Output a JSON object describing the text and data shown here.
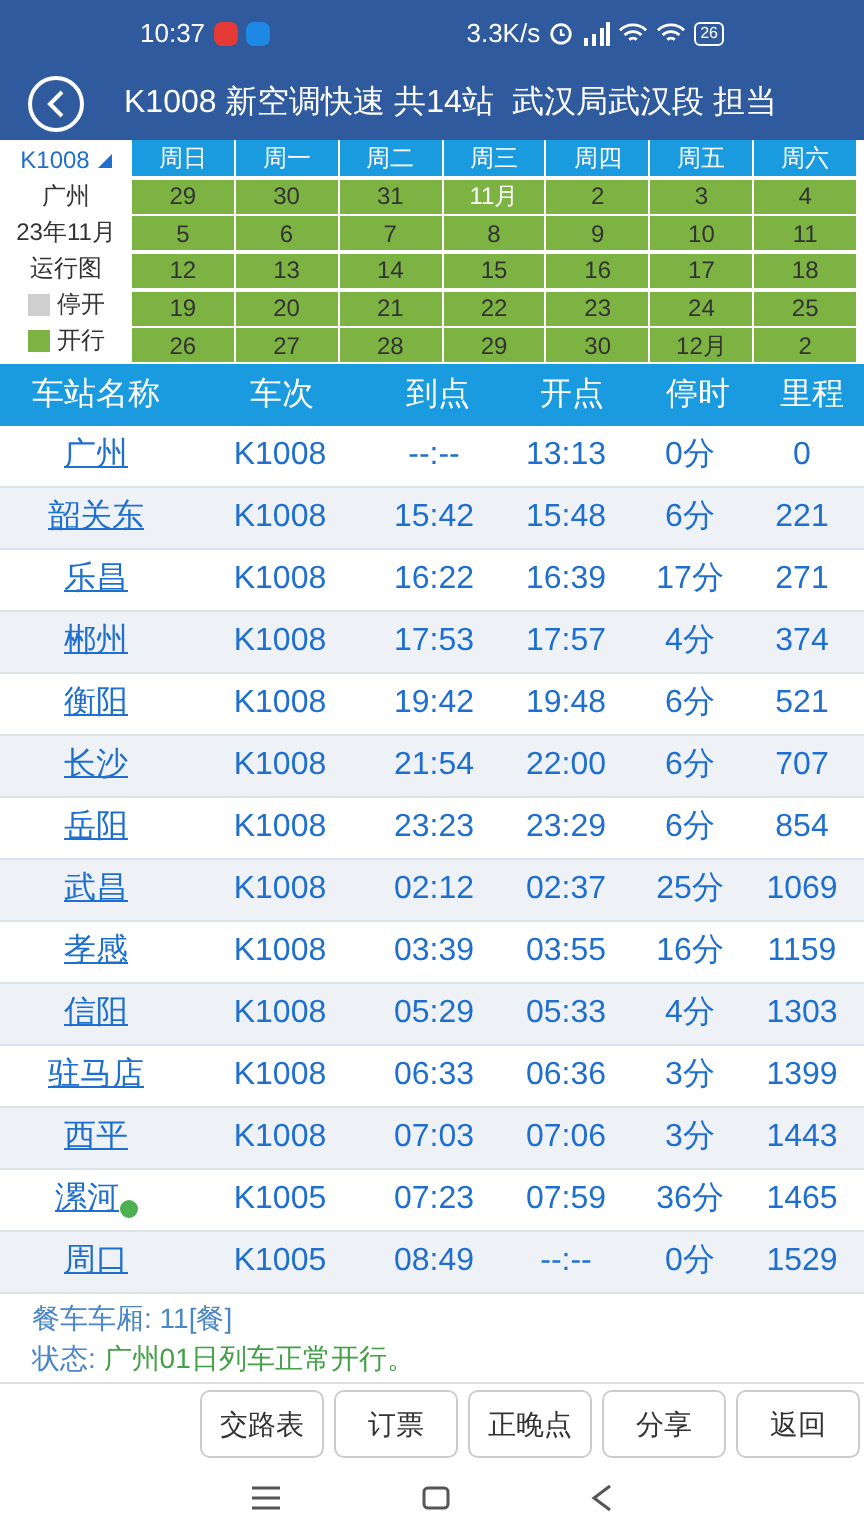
{
  "status_bar": {
    "time": "10:37",
    "speed": "3.3K/s",
    "battery": "26"
  },
  "title_bar": {
    "title": "K1008 新空调快速 共14站  武汉局武汉段 担当"
  },
  "calendar": {
    "train": "K1008",
    "station": "广州",
    "month": "23年11月",
    "caption": "运行图",
    "legend": [
      {
        "label": "停开",
        "color": "#cfcfcf"
      },
      {
        "label": "开行",
        "color": "#7cb342"
      }
    ],
    "weekdays": [
      "周日",
      "周一",
      "周二",
      "周三",
      "周四",
      "周五",
      "周六"
    ],
    "weeks": [
      [
        {
          "text": "29",
          "running": true,
          "selected": false
        },
        {
          "text": "30",
          "running": true,
          "selected": false
        },
        {
          "text": "31",
          "running": true,
          "selected": false
        },
        {
          "text": "11月",
          "running": true,
          "selected": true
        },
        {
          "text": "2",
          "running": true,
          "selected": false
        },
        {
          "text": "3",
          "running": true,
          "selected": false
        },
        {
          "text": "4",
          "running": true,
          "selected": false
        }
      ],
      [
        {
          "text": "5",
          "running": true,
          "selected": false
        },
        {
          "text": "6",
          "running": true,
          "selected": false
        },
        {
          "text": "7",
          "running": true,
          "selected": false
        },
        {
          "text": "8",
          "running": true,
          "selected": false
        },
        {
          "text": "9",
          "running": true,
          "selected": false
        },
        {
          "text": "10",
          "running": true,
          "selected": false
        },
        {
          "text": "11",
          "running": true,
          "selected": false
        }
      ],
      [
        {
          "text": "12",
          "running": true,
          "selected": false
        },
        {
          "text": "13",
          "running": true,
          "selected": false
        },
        {
          "text": "14",
          "running": true,
          "selected": false
        },
        {
          "text": "15",
          "running": true,
          "selected": false
        },
        {
          "text": "16",
          "running": true,
          "selected": false
        },
        {
          "text": "17",
          "running": true,
          "selected": false
        },
        {
          "text": "18",
          "running": true,
          "selected": false
        }
      ],
      [
        {
          "text": "19",
          "running": true,
          "selected": false
        },
        {
          "text": "20",
          "running": true,
          "selected": false
        },
        {
          "text": "21",
          "running": true,
          "selected": false
        },
        {
          "text": "22",
          "running": true,
          "selected": false
        },
        {
          "text": "23",
          "running": true,
          "selected": false
        },
        {
          "text": "24",
          "running": true,
          "selected": false
        },
        {
          "text": "25",
          "running": true,
          "selected": false
        }
      ],
      [
        {
          "text": "26",
          "running": true,
          "selected": false
        },
        {
          "text": "27",
          "running": true,
          "selected": false
        },
        {
          "text": "28",
          "running": true,
          "selected": false
        },
        {
          "text": "29",
          "running": true,
          "selected": false
        },
        {
          "text": "30",
          "running": true,
          "selected": false
        },
        {
          "text": "12月",
          "running": true,
          "selected": false
        },
        {
          "text": "2",
          "running": true,
          "selected": false
        }
      ]
    ]
  },
  "table": {
    "columns": [
      "车站名称",
      "车次",
      "到点",
      "开点",
      "停时",
      "里程"
    ],
    "rows": [
      {
        "station": "广州",
        "train": "K1008",
        "arrive": "--:--",
        "depart": "13:13",
        "stop": "0分",
        "distance": "0",
        "meal": false
      },
      {
        "station": "韶关东",
        "train": "K1008",
        "arrive": "15:42",
        "depart": "15:48",
        "stop": "6分",
        "distance": "221",
        "meal": false
      },
      {
        "station": "乐昌",
        "train": "K1008",
        "arrive": "16:22",
        "depart": "16:39",
        "stop": "17分",
        "distance": "271",
        "meal": false
      },
      {
        "station": "郴州",
        "train": "K1008",
        "arrive": "17:53",
        "depart": "17:57",
        "stop": "4分",
        "distance": "374",
        "meal": false
      },
      {
        "station": "衡阳",
        "train": "K1008",
        "arrive": "19:42",
        "depart": "19:48",
        "stop": "6分",
        "distance": "521",
        "meal": false
      },
      {
        "station": "长沙",
        "train": "K1008",
        "arrive": "21:54",
        "depart": "22:00",
        "stop": "6分",
        "distance": "707",
        "meal": false
      },
      {
        "station": "岳阳",
        "train": "K1008",
        "arrive": "23:23",
        "depart": "23:29",
        "stop": "6分",
        "distance": "854",
        "meal": false
      },
      {
        "station": "武昌",
        "train": "K1008",
        "arrive": "02:12",
        "depart": "02:37",
        "stop": "25分",
        "distance": "1069",
        "meal": false
      },
      {
        "station": "孝感",
        "train": "K1008",
        "arrive": "03:39",
        "depart": "03:55",
        "stop": "16分",
        "distance": "1159",
        "meal": false
      },
      {
        "station": "信阳",
        "train": "K1008",
        "arrive": "05:29",
        "depart": "05:33",
        "stop": "4分",
        "distance": "1303",
        "meal": false
      },
      {
        "station": "驻马店",
        "train": "K1008",
        "arrive": "06:33",
        "depart": "06:36",
        "stop": "3分",
        "distance": "1399",
        "meal": false
      },
      {
        "station": "西平",
        "train": "K1008",
        "arrive": "07:03",
        "depart": "07:06",
        "stop": "3分",
        "distance": "1443",
        "meal": false
      },
      {
        "station": "漯河",
        "train": "K1005",
        "arrive": "07:23",
        "depart": "07:59",
        "stop": "36分",
        "distance": "1465",
        "meal": true
      },
      {
        "station": "周口",
        "train": "K1005",
        "arrive": "08:49",
        "depart": "--:--",
        "stop": "0分",
        "distance": "1529",
        "meal": false
      }
    ]
  },
  "info": {
    "dining_label": "餐车车厢: 11[餐]",
    "status_label": "状态: ",
    "status_text": "广州01日列车正常开行。"
  },
  "buttons": [
    "交路表",
    "订票",
    "正晚点",
    "分享",
    "返回"
  ]
}
